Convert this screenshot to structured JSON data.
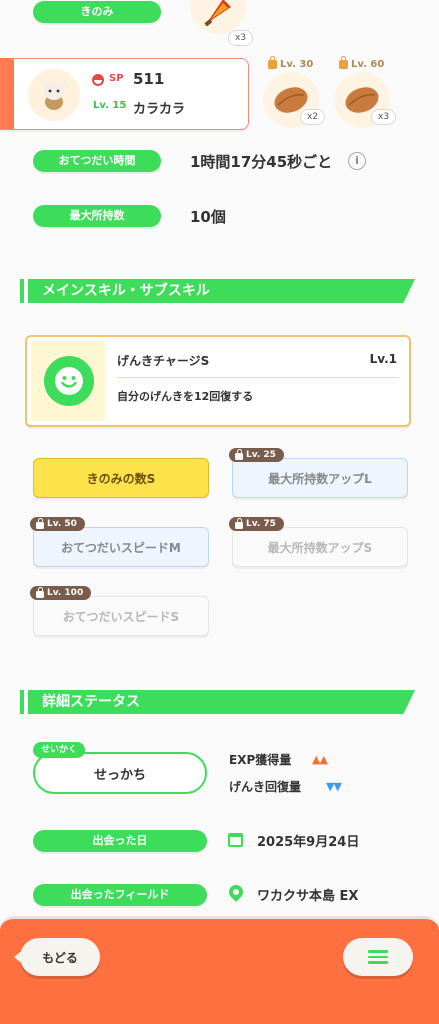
{
  "berry": {
    "label": "きのみ",
    "count": "x3"
  },
  "helper": {
    "sp_label": "SP",
    "sp_value": "511",
    "level": "Lv. 15",
    "name": "カラカラ"
  },
  "ingredients": [
    {
      "unlock": "Lv. 30",
      "count": "x2"
    },
    {
      "unlock": "Lv. 60",
      "count": "x3"
    }
  ],
  "stats": {
    "help_time_label": "おてつだい時間",
    "help_time_value": "1時間17分45秒ごと",
    "max_carry_label": "最大所持数",
    "max_carry_value": "10個"
  },
  "skills_section": {
    "title": "メインスキル・サブスキル",
    "main_skill": {
      "name": "げんきチャージS",
      "level": "Lv.1",
      "description": "自分のげんきを12回復する"
    },
    "sub_skills": [
      {
        "label": "きのみの数S",
        "unlock": "",
        "style": "yellow"
      },
      {
        "label": "最大所持数アップL",
        "unlock": "Lv. 25",
        "style": "blue"
      },
      {
        "label": "おてつだいスピードM",
        "unlock": "Lv. 50",
        "style": "blue"
      },
      {
        "label": "最大所持数アップS",
        "unlock": "Lv. 75",
        "style": "white"
      },
      {
        "label": "おてつだいスピードS",
        "unlock": "Lv. 100",
        "style": "white"
      }
    ]
  },
  "details_section": {
    "title": "詳細ステータス",
    "nature_tag": "せいかく",
    "nature_value": "せっかち",
    "exp_label": "EXP獲得量",
    "energy_label": "げんき回復量",
    "met_date_label": "出会った日",
    "met_date_value": "2025年9月24日",
    "met_field_label": "出会ったフィールド",
    "met_field_value": "ワカクサ本島 EX"
  },
  "footer": {
    "back_label": "もどる"
  },
  "colors": {
    "accent_green": "#3ddc5b",
    "footer_orange": "#ff7040",
    "up_arrow": "#ff6a3d",
    "down_arrow": "#3a9cf0"
  }
}
